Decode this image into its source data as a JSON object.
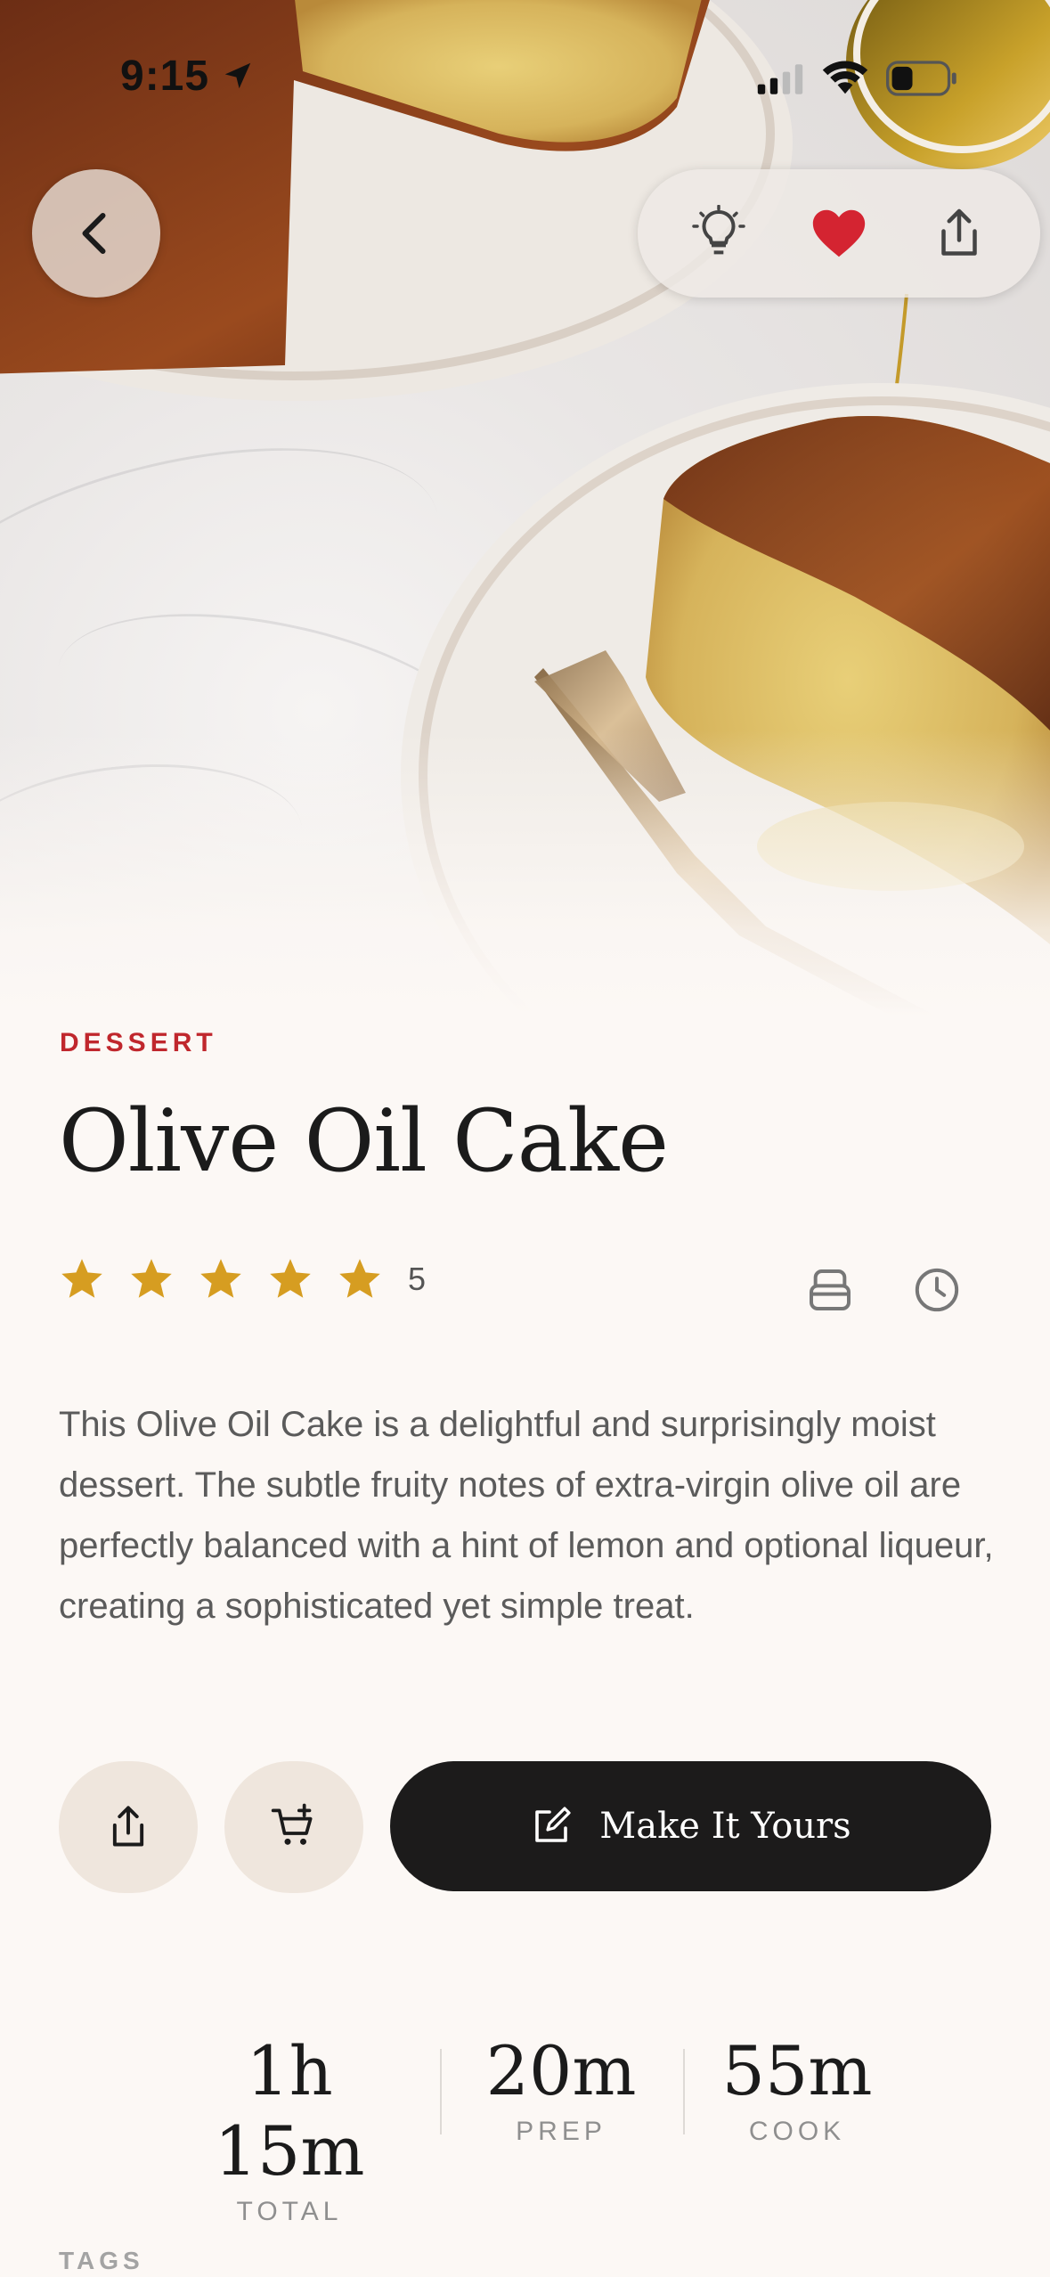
{
  "status_bar": {
    "time": "9:15",
    "icons": [
      "location-arrow-icon",
      "cellular-signal-icon",
      "wifi-icon",
      "battery-icon"
    ]
  },
  "hero": {
    "image": "olive-oil-cake-photo",
    "back_icon": "chevron-left-icon",
    "actions": [
      "lightbulb-icon",
      "heart-icon",
      "share-icon"
    ],
    "favorite_color": "#d42431"
  },
  "recipe": {
    "category": "DESSERT",
    "title": "Olive Oil Cake",
    "rating": 5,
    "rating_count": "5",
    "star_color": "#d69d21",
    "meta_icons": [
      "food-container-icon",
      "clock-icon"
    ],
    "description": "This Olive Oil Cake is a delightful and surprisingly moist dessert. The subtle fruity notes of extra-virgin olive oil are perfectly balanced with a hint of lemon and optional liqueur, creating a sophisticated yet simple treat."
  },
  "actions": {
    "share_icon": "share-icon",
    "cart_icon": "add-to-cart-icon",
    "make_icon": "edit-icon",
    "make_label": "Make It Yours"
  },
  "times": {
    "total_value": "1h 15m",
    "total_label": "TOTAL",
    "prep_value": "20m",
    "prep_label": "PREP",
    "cook_value": "55m",
    "cook_label": "COOK"
  },
  "tags": {
    "label": "TAGS"
  }
}
